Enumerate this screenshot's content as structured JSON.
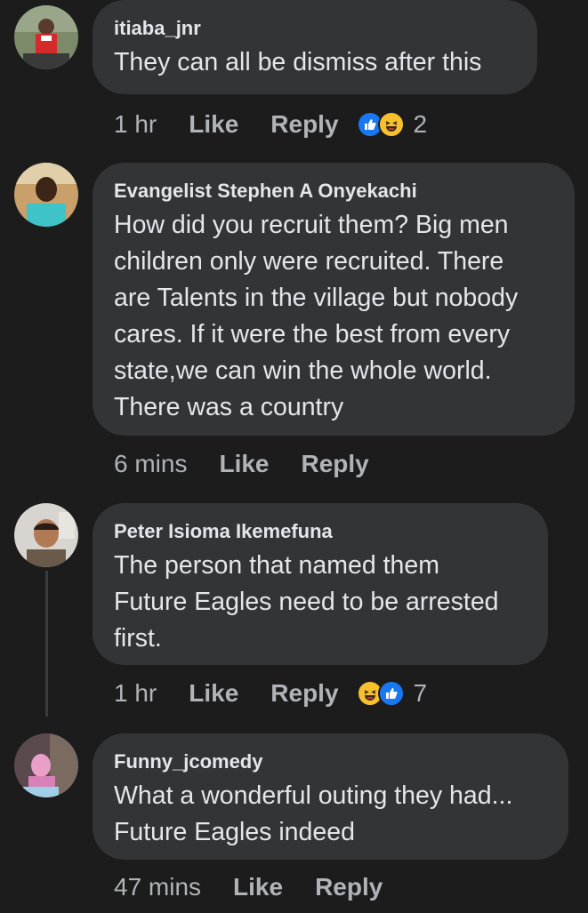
{
  "comments": [
    {
      "author": "itiaba_jnr",
      "text": "They can all be dismiss after this",
      "time": "1 hr",
      "like_label": "Like",
      "reply_label": "Reply",
      "reactions": [
        "like-icon",
        "haha-icon"
      ],
      "reaction_count": "2"
    },
    {
      "author": "Evangelist Stephen A Onyekachi",
      "text": "How did you recruit them? Big men\nchildren only were recruited. There\nare Talents in the village but nobody\ncares. If it were the best from every\nstate,we can win the whole world.\nThere was a country",
      "time": "6 mins",
      "like_label": "Like",
      "reply_label": "Reply"
    },
    {
      "author": "Peter Isioma Ikemefuna",
      "text": "The person that named them\nFuture Eagles need to be arrested\nfirst.",
      "time": "1 hr",
      "like_label": "Like",
      "reply_label": "Reply",
      "reactions": [
        "haha-icon",
        "like-icon"
      ],
      "reaction_count": "7"
    },
    {
      "author": "Funny_jcomedy",
      "text": "What a wonderful outing they had...\nFuture Eagles indeed",
      "time": "47 mins",
      "like_label": "Like",
      "reply_label": "Reply"
    }
  ],
  "colors": {
    "background": "#1c1c1d",
    "bubble": "#333436",
    "text": "#e4e6eb",
    "meta": "#b0b3b8",
    "like_blue": "#1877f2",
    "haha_yellow": "#f7c12e"
  }
}
